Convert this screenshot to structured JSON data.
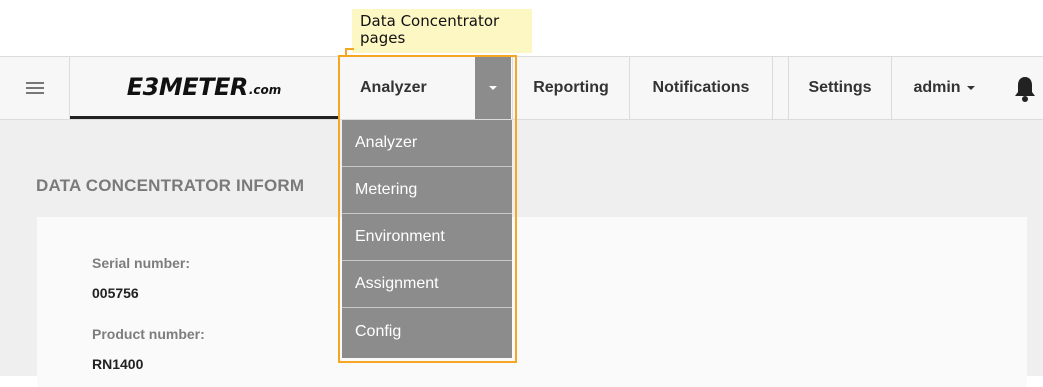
{
  "annotation": {
    "callout_line1": "Data Concentrator",
    "callout_line2": "pages",
    "highlight_color": "#f5a623"
  },
  "navbar": {
    "menu_icon": "hamburger-icon",
    "brand_main": "E3METER",
    "brand_sub": ".com",
    "items": [
      {
        "label": "Analyzer"
      },
      {
        "label": "Reporting"
      },
      {
        "label": "Notifications"
      },
      {
        "label": "Settings"
      },
      {
        "label": "admin"
      }
    ],
    "bell_icon": "bell-icon"
  },
  "dropdown": {
    "items": [
      {
        "label": "Analyzer"
      },
      {
        "label": "Metering"
      },
      {
        "label": "Environment"
      },
      {
        "label": "Assignment"
      },
      {
        "label": "Config"
      }
    ]
  },
  "page": {
    "section_title": "DATA CONCENTRATOR INFORM",
    "fields": [
      {
        "label": "Serial number:",
        "value": "005756"
      },
      {
        "label": "Product number:",
        "value": "RN1400"
      }
    ]
  }
}
